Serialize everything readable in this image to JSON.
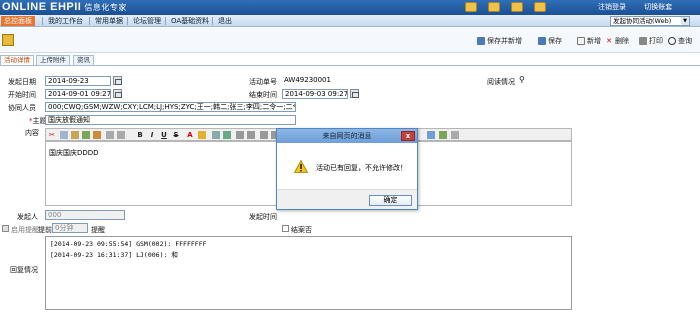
{
  "header": {
    "logo_text": "ONLINE EHPII",
    "logo_sub": "信息化专家",
    "links": [
      "注销登录",
      "切换账套"
    ]
  },
  "nav": {
    "items": [
      "总控面板",
      "我的工作台",
      "常用单据",
      "论坛管理",
      "OA基础资料",
      "退出"
    ],
    "active_index": 0,
    "process_select": "发起协同活动(Web)"
  },
  "toolbar": {
    "buttons": [
      "保存并新增",
      "保存",
      "新增",
      "删除",
      "打印",
      "查询"
    ]
  },
  "tabs": [
    "活动详情",
    "上传附件",
    "资讯"
  ],
  "form": {
    "start_date_label": "发起日期",
    "start_date": "2014-09-23",
    "activity_no_label": "活动单号",
    "activity_no": "AW49230001",
    "read_status_label": "阅读情况",
    "begin_time_label": "开始时间",
    "begin_time": "2014-09-01 09:27",
    "end_time_label": "结束时间",
    "end_time": "2014-09-03 09:27",
    "participants_label": "协同人员",
    "participants": "000;CWQ;GSM;WZW;CXY;LCM;LJ;HYS;ZYC;王一;韩二;张三;李四;二令一;二令二",
    "subject_label": "主题",
    "subject": "国庆放假通知",
    "content_label": "内容",
    "content_text": "国庆国庆DDDD",
    "initiator_label": "发起人",
    "initiator": "000",
    "send_time_label": "发起时间",
    "remind_label": "启用提醒",
    "remind_prefix": "提前",
    "remind_value": "0分钟",
    "remind_suffix": "提醒",
    "closed_label": "结案否",
    "reply_label": "回复情况"
  },
  "replies": [
    "[2014-09-23 09:55:54] GSM(002): FFFFFFFF",
    "[2014-09-23 16:31:37] LJ(006): 和"
  ],
  "dialog": {
    "title": "来自网页的消息",
    "message": "活动已有回复，不允许修改！",
    "ok_label": "确定",
    "close_symbol": "x"
  },
  "editor_toolbar": {
    "labels": [
      "B",
      "I",
      "U",
      "S",
      "A"
    ]
  },
  "colors": {
    "header_blue": "#1c4f93",
    "nav_active": "#e8742e",
    "dialog_title": "#6f9fd8",
    "warning_yellow": "#f5c518"
  }
}
